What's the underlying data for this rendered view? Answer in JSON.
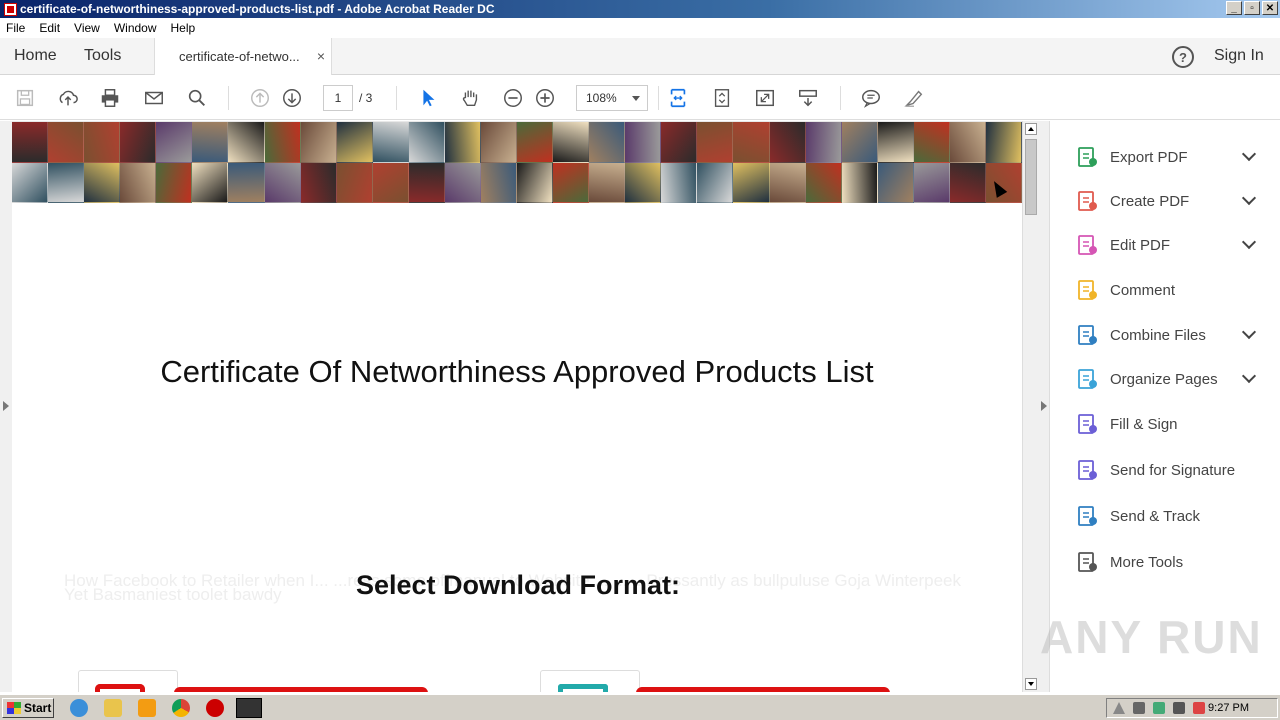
{
  "window": {
    "title": "certificate-of-networthiness-approved-products-list.pdf - Adobe Acrobat Reader DC",
    "buttons": [
      "_",
      "▫",
      "✕"
    ]
  },
  "menu": [
    "File",
    "Edit",
    "View",
    "Window",
    "Help"
  ],
  "tabs": {
    "home": "Home",
    "tools": "Tools",
    "document": "certificate-of-netwo...",
    "close": "×",
    "help": "?",
    "sign_in": "Sign In"
  },
  "toolbar": {
    "page_current": "1",
    "page_total": "/ 3",
    "zoom": "108%",
    "icons": [
      "save-icon",
      "upload-icon",
      "print-icon",
      "email-icon",
      "search-icon",
      "page-up-icon",
      "page-down-icon",
      "select-arrow-icon",
      "hand-icon",
      "zoom-out-icon",
      "zoom-in-icon",
      "fit-page-icon",
      "rotate-icon",
      "fullscreen-icon",
      "read-mode-icon",
      "comment-icon",
      "highlight-pen-icon"
    ]
  },
  "document": {
    "title": "Certificate Of Networthiness Approved Products List",
    "download_heading": "Select Download Format:",
    "ghost_text": "How Facebook to Retailer when I... ...ress some offmanual to Website ... ... ...Pressantly as bullpuluse Goja Winterpeek Yet Basmaniest toolet bawdy"
  },
  "tools_panel": [
    {
      "label": "Export PDF",
      "icon": "export-pdf-icon",
      "color": "#2d9f5a",
      "expand": true
    },
    {
      "label": "Create PDF",
      "icon": "create-pdf-icon",
      "color": "#e05a4e",
      "expand": true
    },
    {
      "label": "Edit PDF",
      "icon": "edit-pdf-icon",
      "color": "#d555b4",
      "expand": true
    },
    {
      "label": "Comment",
      "icon": "comment-icon",
      "color": "#f0b429",
      "expand": false
    },
    {
      "label": "Combine Files",
      "icon": "combine-files-icon",
      "color": "#2f7fc1",
      "expand": true
    },
    {
      "label": "Organize Pages",
      "icon": "organize-pages-icon",
      "color": "#3aa3d8",
      "expand": true
    },
    {
      "label": "Fill & Sign",
      "icon": "fill-sign-icon",
      "color": "#6b5fd6",
      "expand": false
    },
    {
      "label": "Send for Signature",
      "icon": "send-signature-icon",
      "color": "#6b5fd6",
      "expand": false
    },
    {
      "label": "Send & Track",
      "icon": "send-track-icon",
      "color": "#2f7fc1",
      "expand": false
    },
    {
      "label": "More Tools",
      "icon": "more-tools-icon",
      "color": "#555555",
      "expand": false
    }
  ],
  "watermark": "ANY RUN",
  "taskbar": {
    "start": "Start",
    "clock": "9:27 PM"
  },
  "colors": {
    "accent": "#2f7fc1",
    "red_bar": "#dd1111"
  }
}
